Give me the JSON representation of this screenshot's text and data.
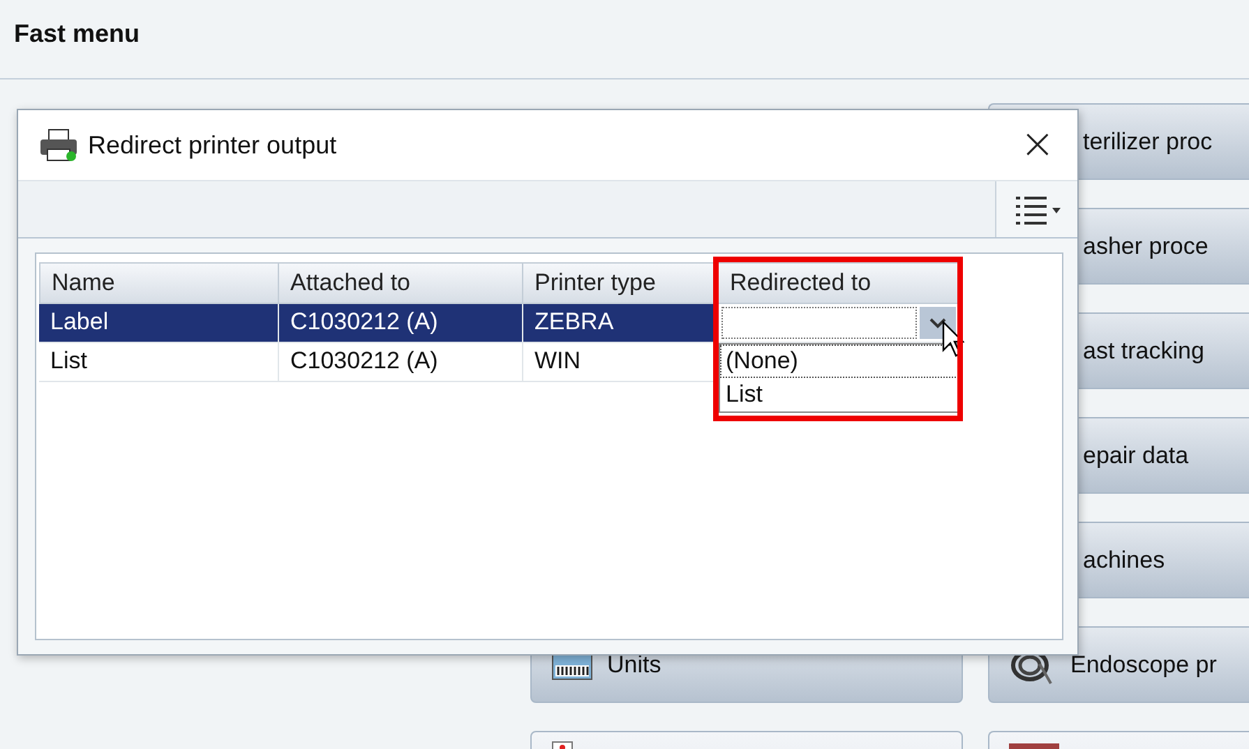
{
  "header": {
    "title": "Fast menu"
  },
  "right_column": [
    {
      "label": "terilizer proc"
    },
    {
      "label": "asher proce"
    },
    {
      "label": "ast tracking"
    },
    {
      "label": "epair data"
    },
    {
      "label": "achines"
    }
  ],
  "bottom_row": [
    {
      "label": "Units"
    },
    {
      "label": "Endoscope pr"
    }
  ],
  "dialog": {
    "title": "Redirect printer output",
    "close": "×",
    "table": {
      "columns": [
        "Name",
        "Attached to",
        "Printer type",
        "Redirected to"
      ],
      "rows": [
        {
          "name": "Label",
          "attached_to": "C1030212 (A)",
          "printer_type": "ZEBRA",
          "selected": true
        },
        {
          "name": "List",
          "attached_to": "C1030212 (A)",
          "printer_type": "WIN",
          "selected": false
        }
      ]
    },
    "dropdown": {
      "options": [
        {
          "label": "(None)",
          "selected": true
        },
        {
          "label": "List",
          "selected": false
        }
      ]
    }
  }
}
